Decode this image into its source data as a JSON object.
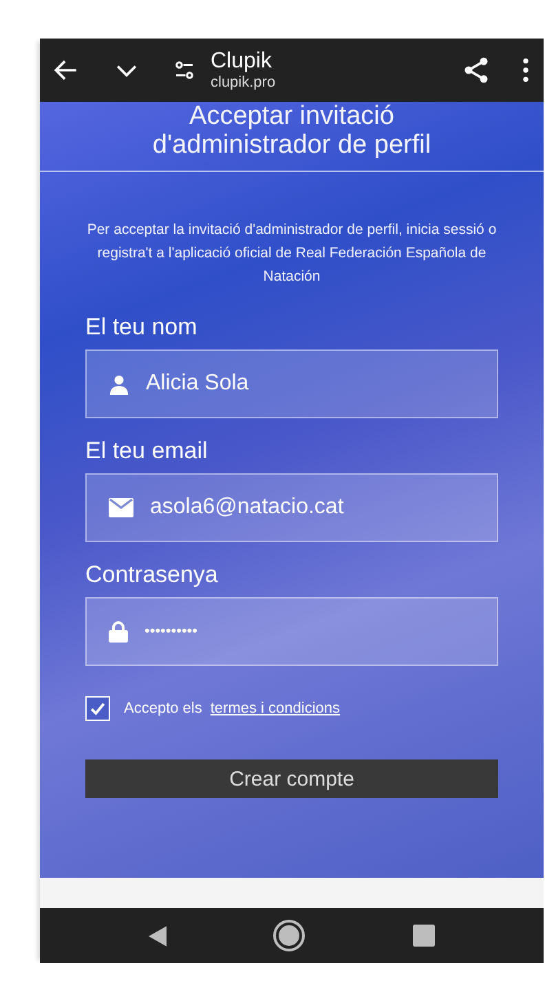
{
  "browser_bar": {
    "title": "Clupik",
    "url": "clupik.pro"
  },
  "page": {
    "title": "Acceptar invitació d'administrador de perfil",
    "intro": "Per acceptar la invitació d'administrador de perfil, inicia sessió o registra't a l'aplicació oficial de Real Federación Española de Natación"
  },
  "fields": [
    {
      "label": "El teu nom",
      "kind": "person",
      "value": "Alicia Sola"
    },
    {
      "label": "El teu email",
      "kind": "mail",
      "value": "asola6@natacio.cat"
    },
    {
      "label": "Contrasenya",
      "kind": "lock",
      "value": "••••••••••"
    }
  ],
  "terms": {
    "checked": true,
    "text": "Accepto els",
    "link": "termes i condicions"
  },
  "submit_button": "Crear compte"
}
